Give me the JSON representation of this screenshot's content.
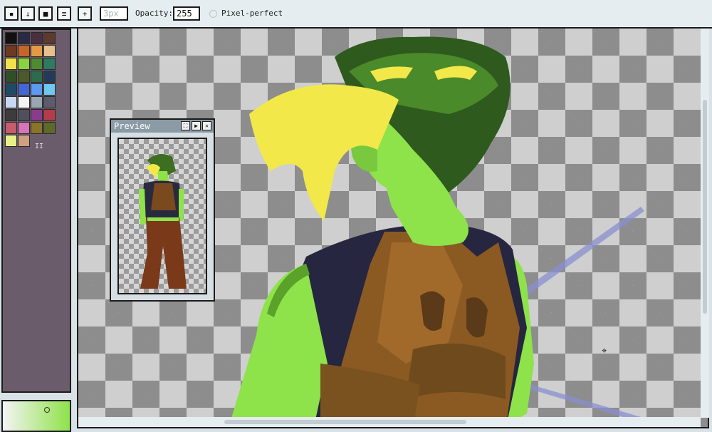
{
  "toolbar": {
    "tools": [
      {
        "name": "lock-tool",
        "glyph": "🔒"
      },
      {
        "name": "download-tool",
        "glyph": "↓"
      },
      {
        "name": "save-tool",
        "glyph": "■"
      },
      {
        "name": "menu-tool",
        "glyph": "≡"
      },
      {
        "name": "add-tool",
        "glyph": "+"
      }
    ],
    "brush_size": "3px",
    "opacity_label": "Opacity:",
    "opacity_value": "255",
    "pixel_perfect_label": "Pixel-perfect"
  },
  "palette": {
    "colors": [
      "#111111",
      "#2b2a44",
      "#4a2f3e",
      "#5c3a2d",
      "#6e3a22",
      "#c7642a",
      "#e49a45",
      "#e8c08e",
      "#f2e24a",
      "#8ad23e",
      "#4e8a2f",
      "#2f7a62",
      "#2f4f26",
      "#4c5a2a",
      "#2c6b4b",
      "#233a58",
      "#1e4a66",
      "#4466d4",
      "#5a9af2",
      "#6ec8f0",
      "#c8d8f0",
      "#f4f4f4",
      "#9aa6b0",
      "#5c5c6c",
      "#3c3c3c",
      "#50505c",
      "#8a3c8c",
      "#b43c48",
      "#c85c6c",
      "#d874b8",
      "#8a7428",
      "#5e6a2a",
      "#e8f088",
      "#d0a080"
    ],
    "page_indicator": "II"
  },
  "colors": {
    "accent_selected": "#8ee24a"
  },
  "preview": {
    "title": "Preview",
    "buttons": [
      "expand",
      "play",
      "close"
    ]
  }
}
